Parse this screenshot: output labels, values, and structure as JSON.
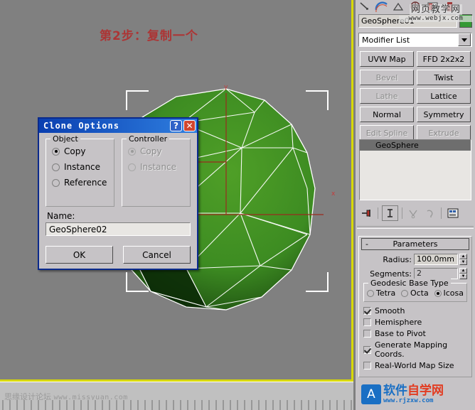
{
  "viewport": {
    "step_title": "第2步：复制一个",
    "axis_y_label": "y",
    "axis_x_label": "x",
    "object_color": "#3d8c22",
    "wire_color": "#ffffff",
    "background": "#808080",
    "active_border_color": "#d8d800"
  },
  "trackbar": {
    "watermark_cn": "思缘设计论坛",
    "watermark_url": "www.missyuan.com"
  },
  "command_panel": {
    "object_name": "GeoSphere01",
    "object_color_swatch": "#339933",
    "modifier_list_label": "Modifier List",
    "modifier_buttons": [
      {
        "label": "UVW Map",
        "enabled": true
      },
      {
        "label": "FFD 2x2x2",
        "enabled": true
      },
      {
        "label": "Bevel",
        "enabled": false
      },
      {
        "label": "Twist",
        "enabled": true
      },
      {
        "label": "Lathe",
        "enabled": false
      },
      {
        "label": "Lattice",
        "enabled": true
      },
      {
        "label": "Normal",
        "enabled": true
      },
      {
        "label": "Symmetry",
        "enabled": true
      },
      {
        "label": "Edit Spline",
        "enabled": false
      },
      {
        "label": "Extrude",
        "enabled": false
      }
    ],
    "modifier_stack": [
      {
        "label": "GeoSphere",
        "selected": true
      }
    ],
    "stack_tools": [
      "pin-stack-icon",
      "show-end-result-icon",
      "make-unique-icon",
      "remove-modifier-icon",
      "configure-modifier-sets-icon"
    ],
    "parameters": {
      "rollout_title": "Parameters",
      "collapse_glyph": "-",
      "radius_label": "Radius:",
      "radius_value": "100.0mm",
      "segments_label": "Segments:",
      "segments_value": "2",
      "base_type_group_label": "Geodesic Base Type",
      "base_type_options": [
        {
          "label": "Tetra",
          "selected": false
        },
        {
          "label": "Octa",
          "selected": false
        },
        {
          "label": "Icosa",
          "selected": true
        }
      ],
      "checkboxes": [
        {
          "label": "Smooth",
          "checked": true
        },
        {
          "label": "Hemisphere",
          "checked": false
        },
        {
          "label": "Base to Pivot",
          "checked": false
        },
        {
          "label": "Generate Mapping Coords.",
          "checked": true
        },
        {
          "label": "Real-World Map Size",
          "checked": false
        }
      ]
    },
    "watermark_top": {
      "cn": "网页教学网",
      "url": "www.webjx.com"
    },
    "watermark_bottom": {
      "badge": "A",
      "cn_blue": "软件",
      "cn_red": "自学网",
      "url": "www.rjzxw.com"
    }
  },
  "clone_dialog": {
    "title": "Clone Options",
    "help_button": "?",
    "close_button": "✕",
    "object_group_label": "Object",
    "object_options": [
      {
        "label": "Copy",
        "selected": true
      },
      {
        "label": "Instance",
        "selected": false
      },
      {
        "label": "Reference",
        "selected": false
      }
    ],
    "controller_group_label": "Controller",
    "controller_enabled": false,
    "controller_options": [
      {
        "label": "Copy",
        "selected": true
      },
      {
        "label": "Instance",
        "selected": false
      }
    ],
    "name_label": "Name:",
    "name_value": "GeoSphere02",
    "ok_label": "OK",
    "cancel_label": "Cancel"
  }
}
